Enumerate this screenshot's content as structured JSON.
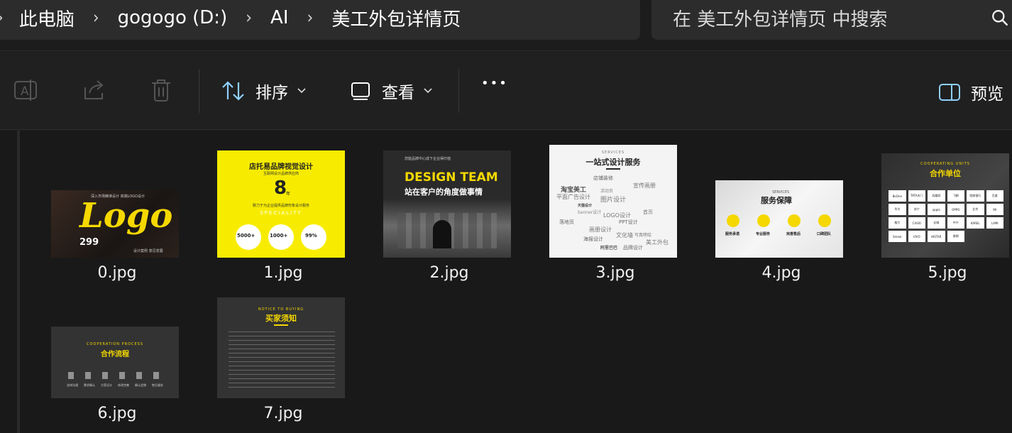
{
  "breadcrumb": {
    "items": [
      "此电脑",
      "gogogo (D:)",
      "AI",
      "美工外包详情页"
    ],
    "leading_chevron": "›",
    "separator": "›"
  },
  "search": {
    "placeholder": "在 美工外包详情页 中搜索",
    "icon": "search-icon"
  },
  "toolbar": {
    "rename_icon": "rename-icon",
    "share_icon": "share-icon",
    "delete_icon": "trash-icon",
    "sort_label": "排序",
    "view_label": "查看",
    "more_label": "•••",
    "preview_label": "预览"
  },
  "files": [
    {
      "name": "0.jpg",
      "thumb": {
        "big": "Logo",
        "price": "299",
        "small": "深入市场精准设计 高端LOGO设计",
        "foot": "设计案例 意见发展"
      }
    },
    {
      "name": "1.jpg",
      "thumb": {
        "title": "店托易品牌视觉设计",
        "sub": "互联网设计品牌供应商",
        "big": "8",
        "unit": "年",
        "desc": "致力于为企业提供品牌形象设计服务",
        "tag": "SPECIALITY",
        "stats": [
          "5000+",
          "1000+",
          "99%"
        ]
      }
    },
    {
      "name": "2.jpg",
      "thumb": {
        "small": "您能品牌中心成下企业得印值",
        "title": "DESIGN TEAM",
        "sub": "站在客户的角度做事情"
      }
    },
    {
      "name": "3.jpg",
      "thumb": {
        "tag": "SERVICES",
        "title": "一站式设计服务",
        "words": [
          "店铺装修",
          "宣传画册",
          "淘宝美工",
          "平面广告设计",
          "图片设计",
          "活动页",
          "天猫设计",
          "LOGO设计",
          "banner设计",
          "海报设计",
          "品牌设计",
          "美工外包",
          "画册设计",
          "阿里巴巴",
          "文化墙",
          "落地页",
          "PPT设计",
          "首页",
          "写真喷绘"
        ]
      }
    },
    {
      "name": "4.jpg",
      "thumb": {
        "tag": "SERVICES",
        "title": "服务保障",
        "items": [
          "服务承诺",
          "专业服务",
          "完善售后",
          "口碑团队"
        ]
      }
    },
    {
      "name": "5.jpg",
      "thumb": {
        "tag": "COOPERATING UNITS",
        "title": "合作单位",
        "logos": [
          "BeOne",
          "TATA木门",
          "凤凰网",
          "飞鹤",
          "招商银行",
          "百度",
          "华为",
          "苏宁",
          "apple",
          "OPPO",
          "北京",
          "MI",
          "格力",
          "CASIO",
          "长城",
          "中兴",
          "KAREL",
          "LAMI",
          "Smeal",
          "VIVO",
          "HISTAR",
          "联想"
        ]
      }
    },
    {
      "name": "6.jpg",
      "thumb": {
        "tag": "COOPERATION PROCESS",
        "title": "合作流程",
        "steps": [
          "咨询沟通",
          "需求确认",
          "方案设计",
          "修改完善",
          "确认定稿",
          "售后服务"
        ]
      }
    },
    {
      "name": "7.jpg",
      "thumb": {
        "tag": "NOTICE TO BUYING",
        "title": "买家须知"
      }
    }
  ]
}
